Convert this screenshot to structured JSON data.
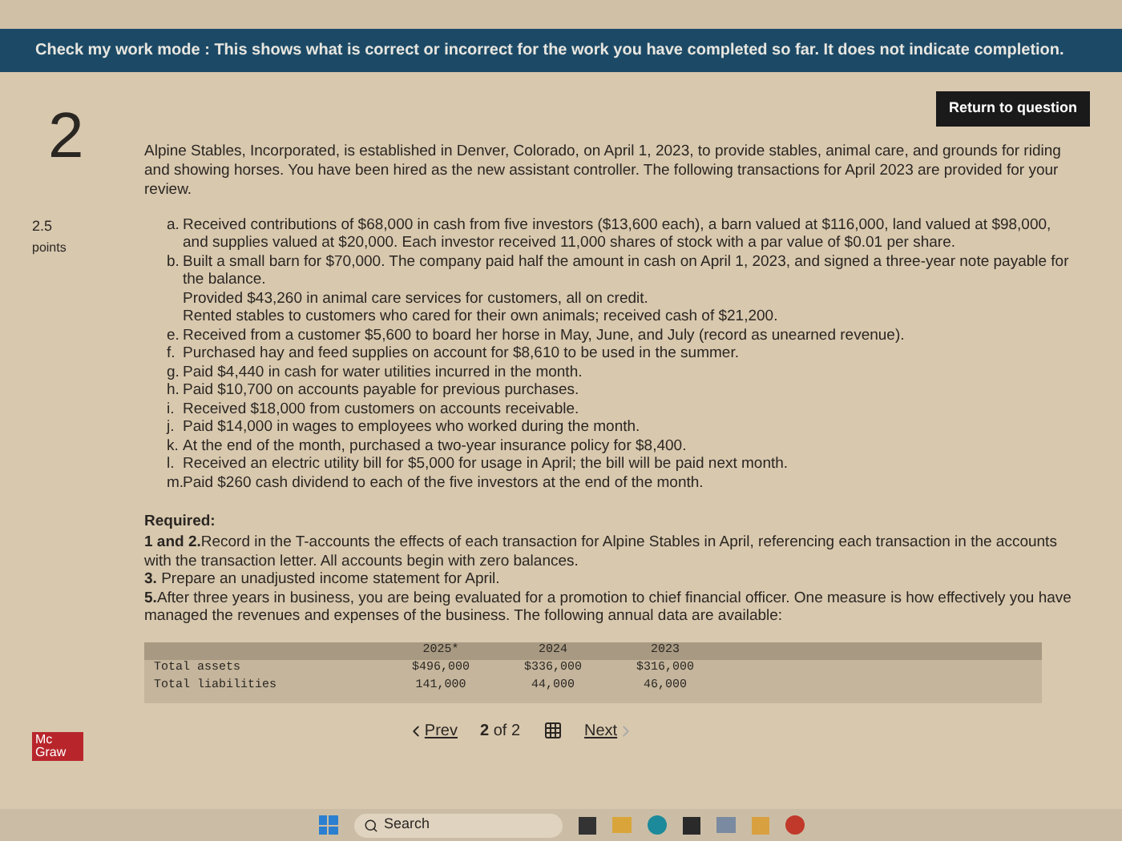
{
  "banner": "Check my work mode : This shows what is correct or incorrect for the work you have completed so far. It does not indicate completion.",
  "return_button": "Return to question",
  "question_number": "2",
  "points": {
    "value": "2.5",
    "label": "points"
  },
  "intro": "Alpine Stables, Incorporated, is established in Denver, Colorado, on April 1, 2023, to provide stables, animal care, and grounds for riding and showing horses. You have been hired as the new assistant controller. The following transactions for April 2023 are provided for your review.",
  "transactions": [
    {
      "letter": "a.",
      "text": "Received contributions of $68,000 in cash from five investors ($13,600 each), a barn valued at $116,000, land valued at $98,000, and supplies valued at $20,000. Each investor received 11,000 shares of stock with a par value of $0.01 per share."
    },
    {
      "letter": "b.",
      "text": "Built a small barn for $70,000. The company paid half the amount in cash on April 1, 2023, and signed a three-year note payable for the balance."
    },
    {
      "text": "Provided $43,260 in animal care services for customers, all on credit."
    },
    {
      "text": "Rented stables to customers who cared for their own animals; received cash of $21,200."
    },
    {
      "letter": "e.",
      "text": "Received from a customer $5,600 to board her horse in May, June, and July (record as unearned revenue)."
    },
    {
      "letter": "f.",
      "text": "Purchased hay and feed supplies on account for $8,610 to be used in the summer."
    },
    {
      "letter": "g.",
      "text": "Paid $4,440 in cash for water utilities incurred in the month."
    },
    {
      "letter": "h.",
      "text": "Paid $10,700 on accounts payable for previous purchases."
    },
    {
      "letter": "i.",
      "text": "Received $18,000 from customers on accounts receivable."
    },
    {
      "letter": "j.",
      "text": "Paid $14,000 in wages to employees who worked during the month."
    },
    {
      "letter": "k.",
      "text": "At the end of the month, purchased a two-year insurance policy for $8,400."
    },
    {
      "letter": "l.",
      "text": "Received an electric utility bill for $5,000 for usage in April; the bill will be paid next month."
    },
    {
      "letter": "m.",
      "text": "Paid $260 cash dividend to each of the five investors at the end of the month."
    }
  ],
  "required_heading": "Required:",
  "requirements": [
    {
      "number": "1 and 2.",
      "text": "Record in the T-accounts the effects of each transaction for Alpine Stables in April, referencing each transaction in the accounts with the transaction letter. All accounts begin with zero balances."
    },
    {
      "number": "3.",
      "text": " Prepare an unadjusted income statement for April."
    },
    {
      "number": "5.",
      "text": "After three years in business, you are being evaluated for a promotion to chief financial officer. One measure is how effectively you have managed the revenues and expenses of the business. The following annual data are available:"
    }
  ],
  "table": {
    "columns": [
      "2025*",
      "2024",
      "2023"
    ],
    "rows": [
      {
        "label": "Total assets",
        "values": [
          "$496,000",
          "$336,000",
          "$316,000"
        ]
      },
      {
        "label": "Total liabilities",
        "values": [
          "141,000",
          "44,000",
          "46,000"
        ]
      }
    ]
  },
  "logo": "Mc Graw",
  "pager": {
    "prev": "Prev",
    "current": "2",
    "of": "of 2",
    "next": "Next"
  },
  "taskbar": {
    "search": "Search"
  }
}
